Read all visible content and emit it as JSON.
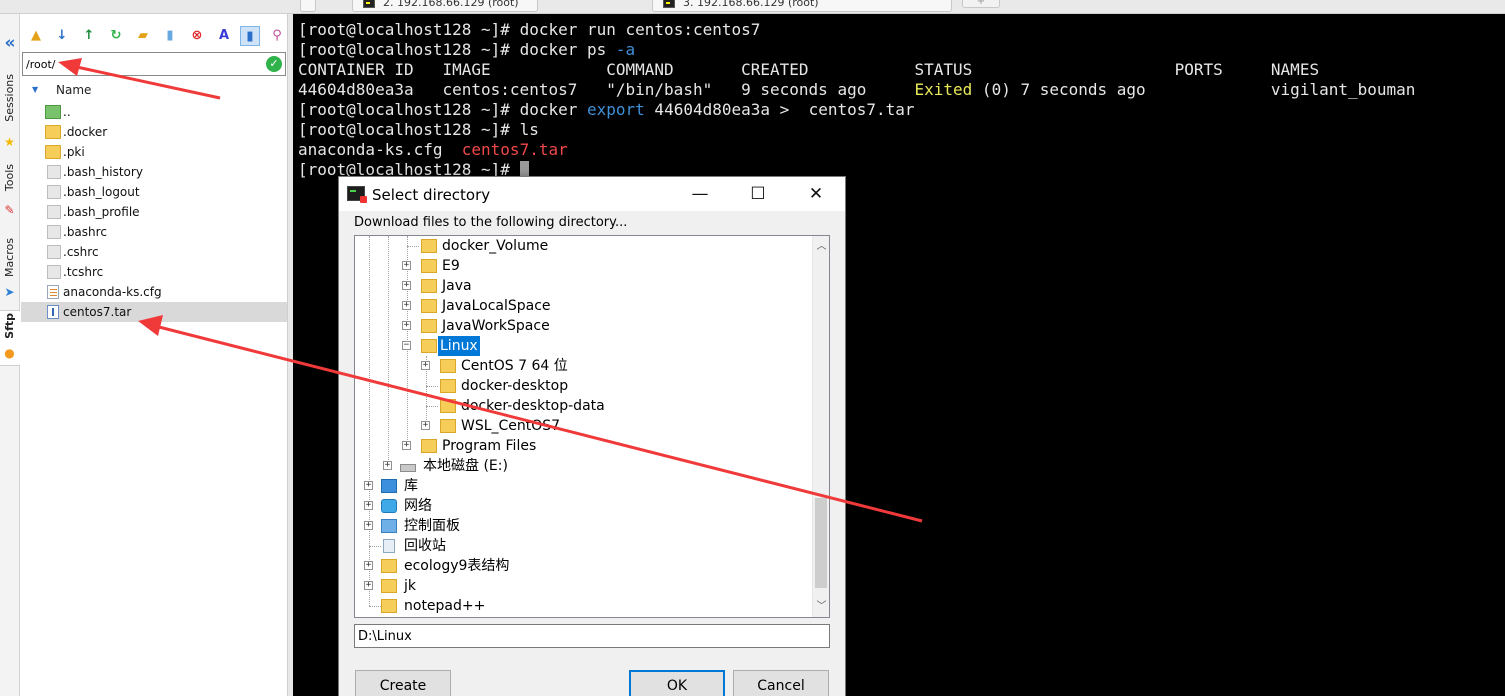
{
  "tabs": [
    {
      "label": "2. 192.168.66.129 (root)"
    },
    {
      "label": "3. 192.168.66.129 (root)"
    }
  ],
  "new_tab_label": "+",
  "sidebar": {
    "collapse_icon": "«",
    "items": [
      {
        "label": "Sessions",
        "icon": "star-icon"
      },
      {
        "label": "Tools",
        "icon": "wrench-icon"
      },
      {
        "label": "Macros",
        "icon": "paper-plane-icon"
      },
      {
        "label": "Sftp",
        "icon": "globe-icon"
      }
    ]
  },
  "sftp": {
    "toolbar_icons": [
      "folder-up-icon",
      "download-icon",
      "upload-icon",
      "refresh-icon",
      "new-folder-icon",
      "new-file-icon",
      "delete-icon",
      "rename-icon",
      "follow-terminal-icon",
      "magic-wand-icon"
    ],
    "path": "/root/",
    "column_name": "Name",
    "files": [
      {
        "name": "..",
        "type": "up"
      },
      {
        "name": ".docker",
        "type": "folder"
      },
      {
        "name": ".pki",
        "type": "folder"
      },
      {
        "name": ".bash_history",
        "type": "file"
      },
      {
        "name": ".bash_logout",
        "type": "file"
      },
      {
        "name": ".bash_profile",
        "type": "file"
      },
      {
        "name": ".bashrc",
        "type": "file"
      },
      {
        "name": ".cshrc",
        "type": "file"
      },
      {
        "name": ".tcshrc",
        "type": "file"
      },
      {
        "name": "anaconda-ks.cfg",
        "type": "cfg"
      },
      {
        "name": "centos7.tar",
        "type": "tar",
        "selected": true
      }
    ]
  },
  "terminal": {
    "prompt": "[root@localhost128 ~]# ",
    "lines": {
      "l1_cmd": "docker run centos:centos7",
      "l2_cmd_a": "docker ps ",
      "l2_cmd_b": "-a",
      "header": "CONTAINER ID   IMAGE            COMMAND       CREATED           STATUS                     PORTS     NAMES",
      "row_a": "44604d80ea3a   centos:centos7   \"/bin/bash\"   9 seconds ago     ",
      "row_status": "Exited",
      "row_b": " (0) 7 seconds ago             vigilant_bouman",
      "l4_cmd_a": "docker ",
      "l4_cmd_b": "export",
      "l4_cmd_c": " 44604d80ea3a ",
      "l4_cmd_d": ">",
      "l4_cmd_e": "  centos7.tar",
      "l5_cmd": "ls",
      "ls_a": "anaconda-ks.cfg  ",
      "ls_b": "centos7.tar",
      "l7_cmd": ""
    }
  },
  "dialog": {
    "title": "Select directory",
    "minimize": "—",
    "maximize": "☐",
    "close": "✕",
    "prompt": "Download files to the following directory...",
    "tree": {
      "docker_volume": "docker_Volume",
      "e9": "E9",
      "java": "Java",
      "java_local": "JavaLocalSpace",
      "java_work": "JavaWorkSpace",
      "linux": "Linux",
      "centos": "CentOS 7 64 位",
      "docker_desktop": "docker-desktop",
      "docker_desktop_data": "docker-desktop-data",
      "wsl": "WSL_CentOS7",
      "program_files": "Program Files",
      "local_disk": "本地磁盘 (E:)",
      "library": "库",
      "network": "网络",
      "control_panel": "控制面板",
      "recycle_bin": "回收站",
      "ecology": "ecology9表结构",
      "jk": "jk",
      "notepad": "notepad++"
    },
    "directory": "D:\\Linux",
    "buttons": {
      "create": "Create",
      "ok": "OK",
      "cancel": "Cancel"
    }
  },
  "colors": {
    "terminal_bg": "#000000",
    "terminal_fg": "#e6e6e6",
    "term_blue": "#3f8fd6",
    "term_red": "#f04848",
    "term_yellow": "#e8e85a",
    "selection": "#0078d7",
    "annotation_arrow": "#f03a3a"
  }
}
